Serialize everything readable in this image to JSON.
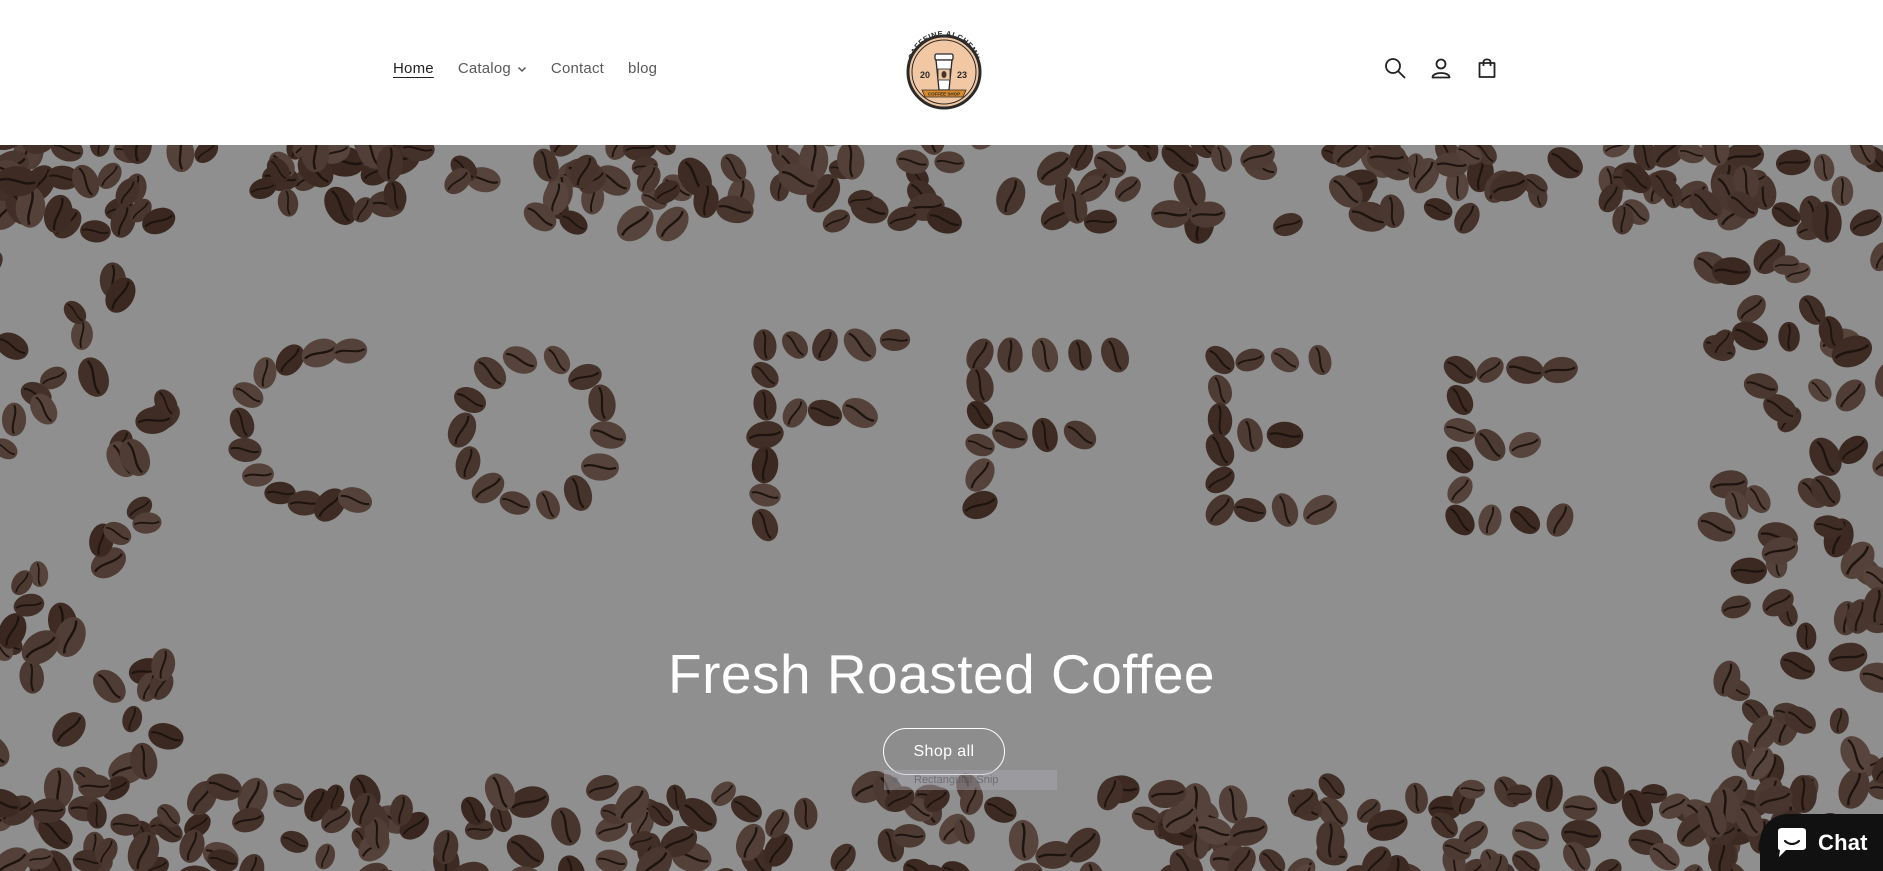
{
  "header": {
    "nav": [
      {
        "label": "Home",
        "active": true
      },
      {
        "label": "Catalog",
        "has_dropdown": true
      },
      {
        "label": "Contact"
      },
      {
        "label": "blog"
      }
    ],
    "logo": {
      "top_text": "CAFFEINE ALCHEMY",
      "left_year": "20",
      "right_year": "23",
      "ribbon_text": "COFFEE SHOP"
    },
    "icons": [
      "search-icon",
      "account-icon",
      "cart-icon"
    ]
  },
  "hero": {
    "heading": "Fresh Roasted Coffee",
    "button_label": "Shop all",
    "overlay_chip": "Rectangular Snip"
  },
  "chat": {
    "label": "Chat"
  },
  "colors": {
    "hero_overlay": "#8f8f8f",
    "bean_dark": "#3b2a22",
    "chat_bg": "#111111",
    "text_white": "#ffffff"
  }
}
